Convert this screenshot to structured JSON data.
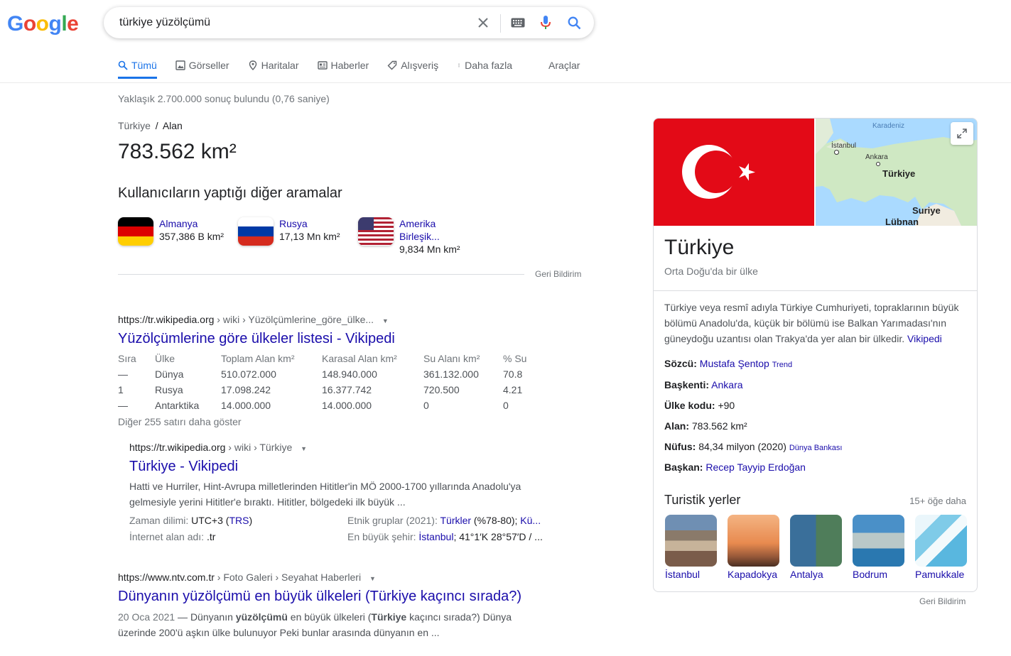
{
  "logo": {
    "letters": [
      "G",
      "o",
      "o",
      "g",
      "l",
      "e"
    ]
  },
  "search": {
    "query": "türkiye yüzölçümü"
  },
  "tabs": [
    {
      "label": "Tümü",
      "icon": "search-icon",
      "active": true
    },
    {
      "label": "Görseller",
      "icon": "image-icon"
    },
    {
      "label": "Haritalar",
      "icon": "map-pin-icon"
    },
    {
      "label": "Haberler",
      "icon": "news-icon"
    },
    {
      "label": "Alışveriş",
      "icon": "tag-icon"
    },
    {
      "label": "Daha fazla",
      "icon": "more-vert-icon"
    }
  ],
  "tools_label": "Araçlar",
  "result_stats": "Yaklaşık 2.700.000 sonuç bulundu (0,76 saniye)",
  "answer": {
    "crumb_entity": "Türkiye",
    "crumb_sep": "/",
    "crumb_attr": "Alan",
    "value": "783.562 km²",
    "people_title": "Kullanıcıların yaptığı diğer aramalar",
    "related": [
      {
        "name": "Almanya",
        "value": "357,386 B km²",
        "flag": "germany"
      },
      {
        "name": "Rusya",
        "value": "17,13 Mn km²",
        "flag": "russia"
      },
      {
        "name_l1": "Amerika",
        "name_l2": "Birleşik...",
        "value": "9,834 Mn km²",
        "flag": "usa"
      }
    ],
    "feedback": "Geri Bildirim"
  },
  "results": [
    {
      "url_host": "https://tr.wikipedia.org",
      "url_path": " › wiki › Yüzölçümlerine_göre_ülke...",
      "title": "Yüzölçümlerine göre ülkeler listesi - Vikipedi",
      "table": {
        "headers": [
          "Sıra",
          "Ülke",
          "Toplam Alan km²",
          "Karasal Alan km²",
          "Su Alanı km²",
          "% Su"
        ],
        "rows": [
          [
            "—",
            "Dünya",
            "510.072.000",
            "148.940.000",
            "361.132.000",
            "70.8"
          ],
          [
            "1",
            "Rusya",
            "17.098.242",
            "16.377.742",
            "720.500",
            "4.21"
          ],
          [
            "—",
            "Antarktika",
            "14.000.000",
            "14.000.000",
            "0",
            "0"
          ]
        ]
      },
      "more_rows": "Diğer 255 satırı daha göster"
    },
    {
      "url_host": "https://tr.wikipedia.org",
      "url_path": " › wiki › Türkiye",
      "title": "Türkiye - Vikipedi",
      "snippet_l1": "Hatti ve Hurriler, Hint-Avrupa milletlerinden Hititler'in MÖ 2000-1700 yıllarında Anadolu'ya",
      "snippet_l2": "gelmesiyle yerini Hititler'e bıraktı. Hititler, bölgedeki ilk büyük ...",
      "facts": {
        "tz_label": "Zaman dilimi:",
        "tz_value": " UTC+3 (",
        "tz_link": "TRS",
        "tz_end": ")",
        "domain_label": "İnternet alan adı:",
        "domain_value": " .tr",
        "ethnic_label": "Etnik gruplar (2021):",
        "ethnic_link": "Türkler",
        "ethnic_value": " (%78-80); ",
        "ethnic_link2": "Kü...",
        "city_label": "En büyük şehir:",
        "city_link": "İstanbul",
        "city_value": "; 41°1′K 28°57′D / ..."
      }
    },
    {
      "url_host": "https://www.ntv.com.tr",
      "url_path": " › Foto Galeri › Seyahat Haberleri",
      "title": "Dünyanın yüzölçümü en büyük ülkeleri (Türkiye kaçıncı sırada?)",
      "date": "20 Oca 2021",
      "snippet_a": " — Dünyanın ",
      "snippet_b": "yüzölçümü",
      "snippet_c": " en büyük ülkeleri (",
      "snippet_d": "Türkiye",
      "snippet_e": " kaçıncı sırada?) Dünya",
      "snippet_l2": "üzerinde 200'ü aşkın ülke bulunuyor Peki bunlar arasında dünyanın en ..."
    }
  ],
  "kp": {
    "map_labels": {
      "sea": "Karadeniz",
      "istanbul": "İstanbul",
      "ankara": "Ankara",
      "country": "Türkiye",
      "syria": "Suriye",
      "lebanon": "Lübnan"
    },
    "title": "Türkiye",
    "subtitle": "Orta Doğu'da bir ülke",
    "desc": "Türkiye veya resmî adıyla Türkiye Cumhuriyeti, topraklarının büyük bölümü Anadolu'da, küçük bir bölümü ise Balkan Yarımadası'nın güneydoğu uzantısı olan Trakya'da yer alan bir ülkedir.",
    "desc_link": "Vikipedi",
    "facts": [
      {
        "label": "Sözcü:",
        "link": "Mustafa Şentop",
        "extra": "Trend"
      },
      {
        "label": "Başkenti:",
        "link": "Ankara"
      },
      {
        "label": "Ülke kodu:",
        "value": "+90"
      },
      {
        "label": "Alan:",
        "value": "783.562 km²"
      },
      {
        "label": "Nüfus:",
        "value": "84,34 milyon (2020)",
        "extra": "Dünya Bankası"
      },
      {
        "label": "Başkan:",
        "link": "Recep Tayyip Erdoğan"
      }
    ],
    "places_title": "Turistik yerler",
    "places_more": "15+ öğe daha",
    "places": [
      "İstanbul",
      "Kapadokya",
      "Antalya",
      "Bodrum",
      "Pamukkale"
    ],
    "feedback": "Geri Bildirim"
  },
  "colors": {
    "accent": "#1a73e8",
    "link": "#1a0dab",
    "flag_red": "#e30a17"
  }
}
